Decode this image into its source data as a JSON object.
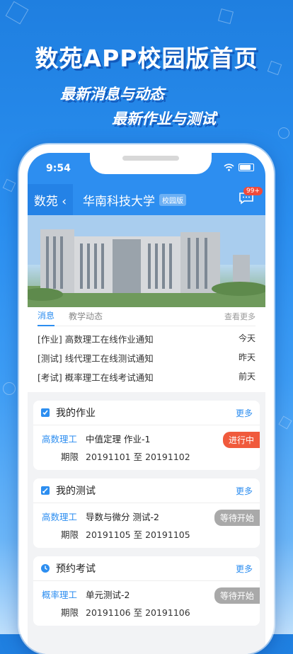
{
  "hero": {
    "title": "数苑APP校园版首页",
    "subtitle1": "最新消息与动态",
    "subtitle2": "最新作业与测试"
  },
  "statusbar": {
    "time": "9:54"
  },
  "navbar": {
    "back_label": "数苑 ‹",
    "school": "华南科技大学",
    "badge": "校园版",
    "msg_count": "99+"
  },
  "news": {
    "tabs": [
      "消息",
      "教学动态"
    ],
    "more": "查看更多",
    "items": [
      {
        "text": "[作业] 高数理工在线作业通知",
        "date": "今天"
      },
      {
        "text": "[测试] 线代理工在线测试通知",
        "date": "昨天"
      },
      {
        "text": "[考试] 概率理工在线考试通知",
        "date": "前天"
      }
    ]
  },
  "cards": [
    {
      "title": "我的作业",
      "more": "更多",
      "subject": "高数理工",
      "name": "中值定理 作业-1",
      "period_label": "期限",
      "period": "20191101 至 20191102",
      "status": "进行中"
    },
    {
      "title": "我的测试",
      "more": "更多",
      "subject": "高数理工",
      "name": "导数与微分 测试-2",
      "period_label": "期限",
      "period": "20191105 至 20191105",
      "status": "等待开始"
    },
    {
      "title": "预约考试",
      "more": "更多",
      "subject": "概率理工",
      "name": "单元测试-2",
      "period_label": "期限",
      "period": "20191106 至 20191106",
      "status": "等待开始"
    }
  ],
  "colors": {
    "primary": "#2d8ef0",
    "status_active": "#f05a3c",
    "status_waiting": "#a9a9a9"
  }
}
